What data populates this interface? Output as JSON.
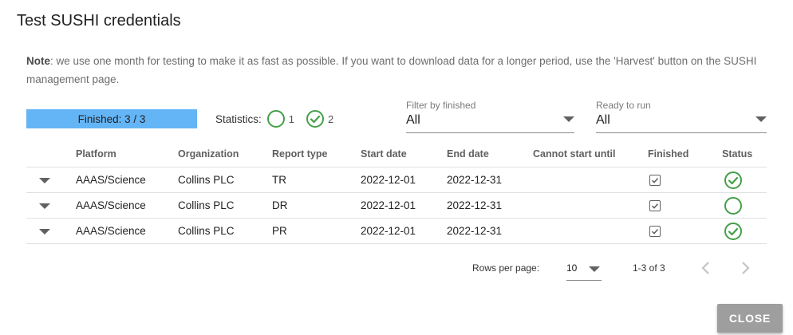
{
  "dialog": {
    "title": "Test SUSHI credentials",
    "note_bold": "Note",
    "note_text": ": we use one month for testing to make it as fast as possible. If you want to download data for a longer period, use the 'Harvest' button on the SUSHI management page."
  },
  "progress": {
    "label": "Finished: 3 / 3",
    "fraction": 1.0,
    "color": "#64b5f6"
  },
  "statistics": {
    "label": "Statistics:",
    "pending_count": "1",
    "success_count": "2",
    "success_color": "#43a047"
  },
  "filters": {
    "finished": {
      "label": "Filter by finished",
      "value": "All"
    },
    "ready": {
      "label": "Ready to run",
      "value": "All"
    }
  },
  "table": {
    "headers": [
      "Platform",
      "Organization",
      "Report type",
      "Start date",
      "End date",
      "Cannot start until",
      "Finished",
      "Status"
    ],
    "rows": [
      {
        "platform": "AAAS/Science",
        "organization": "Collins PLC",
        "report_type": "TR",
        "start": "2022-12-01",
        "end": "2022-12-31",
        "cannot_start_until": "",
        "finished": true,
        "status": "check-circle-icon"
      },
      {
        "platform": "AAAS/Science",
        "organization": "Collins PLC",
        "report_type": "DR",
        "start": "2022-12-01",
        "end": "2022-12-31",
        "cannot_start_until": "",
        "finished": true,
        "status": "empty-circle-icon"
      },
      {
        "platform": "AAAS/Science",
        "organization": "Collins PLC",
        "report_type": "PR",
        "start": "2022-12-01",
        "end": "2022-12-31",
        "cannot_start_until": "",
        "finished": true,
        "status": "check-circle-icon"
      }
    ]
  },
  "pagination": {
    "rows_per_page_label": "Rows per page:",
    "rows_per_page": "10",
    "range": "1-3 of 3"
  },
  "actions": {
    "close_label": "CLOSE"
  }
}
